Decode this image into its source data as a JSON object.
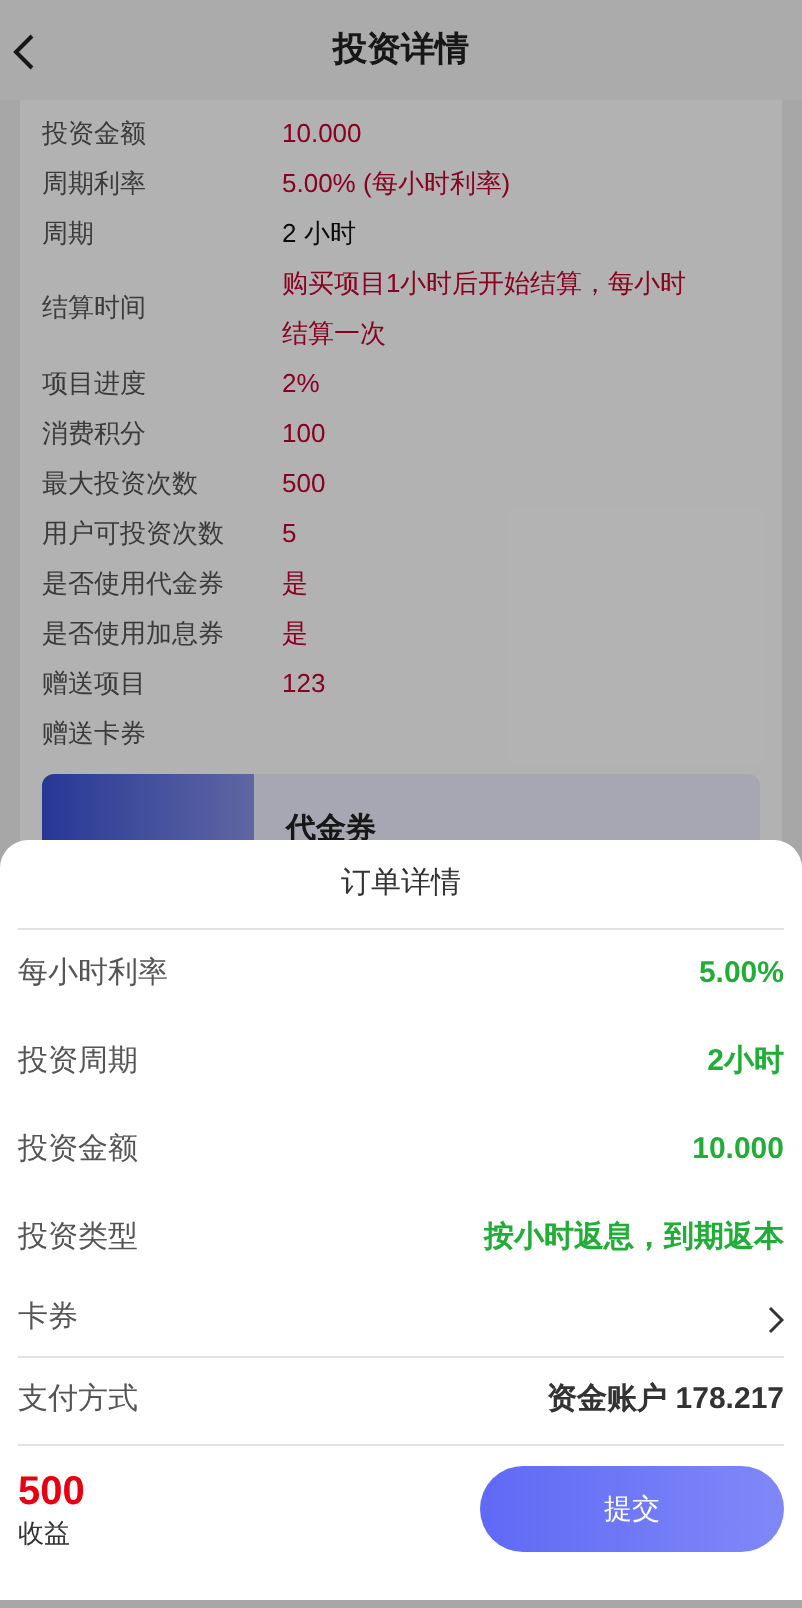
{
  "header": {
    "title": "投资详情"
  },
  "details": [
    {
      "label": "投资金额",
      "value": "10.000",
      "highlight": true
    },
    {
      "label": "周期利率",
      "value": "5.00% (每小时利率)",
      "highlight": true
    },
    {
      "label": "周期",
      "value": "2 小时",
      "highlight": false
    },
    {
      "label": "结算时间",
      "value": "购买项目1小时后开始结算，每小时结算一次",
      "highlight": true
    },
    {
      "label": "项目进度",
      "value": "2%",
      "highlight": true
    },
    {
      "label": "消费积分",
      "value": "100",
      "highlight": true
    },
    {
      "label": "最大投资次数",
      "value": "500",
      "highlight": true
    },
    {
      "label": "用户可投资次数",
      "value": "5",
      "highlight": true
    },
    {
      "label": "是否使用代金券",
      "value": "是",
      "highlight": true
    },
    {
      "label": "是否使用加息券",
      "value": "是",
      "highlight": true
    },
    {
      "label": "赠送项目",
      "value": "123",
      "highlight": true
    },
    {
      "label": "赠送卡券"
    }
  ],
  "coupon": {
    "name": "代金券"
  },
  "order_sheet": {
    "title": "订单详情",
    "rows": [
      {
        "kind": "value",
        "label": "每小时利率",
        "value": "5.00%",
        "color": "#22ac38"
      },
      {
        "kind": "value",
        "label": "投资周期",
        "value": "2小时",
        "color": "#22ac38"
      },
      {
        "kind": "value",
        "label": "投资金额",
        "value": "10.000",
        "color": "#22ac38"
      },
      {
        "kind": "value",
        "label": "投资类型",
        "value": "按小时返息，到期返本",
        "color": "#22ac38"
      },
      {
        "kind": "link",
        "label": "卡券"
      },
      {
        "kind": "value",
        "label": "支付方式",
        "value": "资金账户 178.217",
        "color": "#333333"
      }
    ],
    "income": {
      "amount": "500",
      "label": "收益"
    },
    "submit": "提交"
  }
}
